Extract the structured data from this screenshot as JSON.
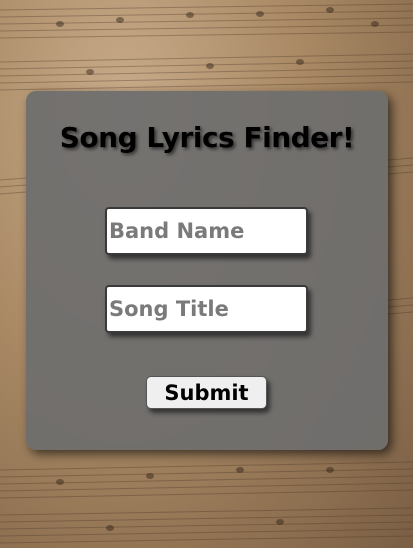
{
  "form": {
    "title": "Song Lyrics Finder!",
    "band_placeholder": "Band Name",
    "song_placeholder": "Song Title",
    "submit_label": "Submit"
  },
  "theme": {
    "card_color": "#6e6e6e",
    "background_tone": "#a98964"
  }
}
